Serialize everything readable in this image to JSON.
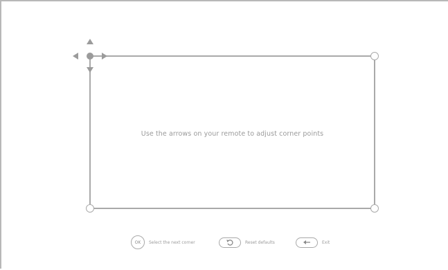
{
  "instruction": "Use the arrows on your remote to adjust corner points",
  "hints": [
    {
      "key_label": "OK",
      "key_icon": "ok-key",
      "label": "Select the next corner"
    },
    {
      "key_icon": "reset-icon",
      "label": "Reset defaults"
    },
    {
      "key_icon": "back-arrow-icon",
      "label": "Exit"
    }
  ],
  "colors": {
    "frame_line": "#a9a9a9",
    "active_corner": "#9b9b9b",
    "text": "#9a9a9a"
  },
  "active_corner": "top-left"
}
